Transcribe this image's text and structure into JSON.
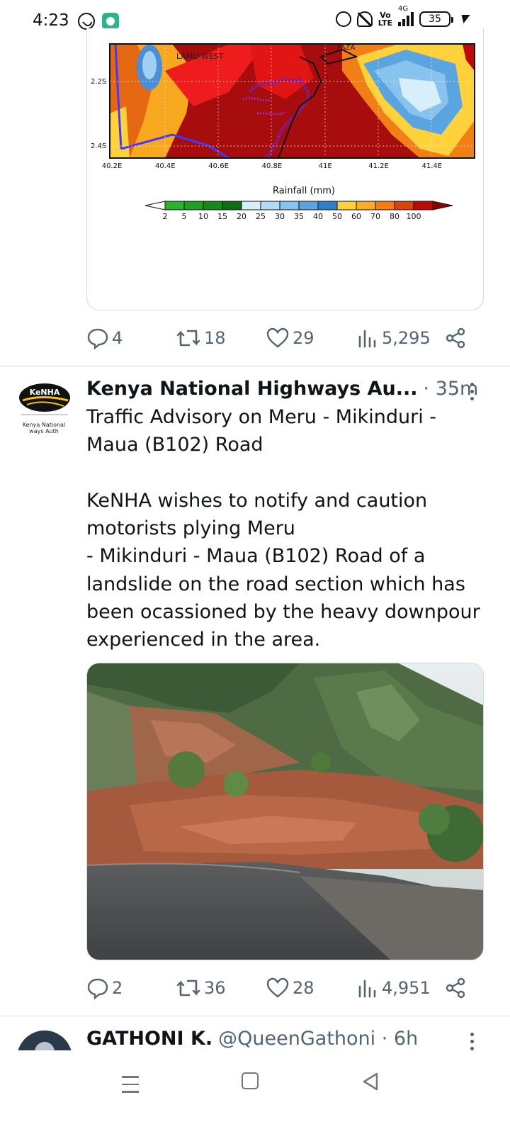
{
  "status_bar": {
    "time": "4:23",
    "network_top": "Vo",
    "network_bottom": "LTE",
    "network_type": "4G",
    "battery": "35",
    "icons": [
      "whatsapp-icon",
      "app-notification-icon",
      "alarm-icon",
      "mute-icon",
      "signal-icon",
      "battery-icon",
      "charging-icon"
    ]
  },
  "map_card": {
    "place_labels": [
      "LAMU WEST",
      "FAZA"
    ],
    "lat_ticks": [
      "2.2S",
      "2.4S"
    ],
    "lon_ticks": [
      "40.2E",
      "40.4E",
      "40.6E",
      "40.8E",
      "41E",
      "41.2E",
      "41.4E"
    ],
    "legend_title": "Rainfall (mm)",
    "legend_values": [
      "2",
      "5",
      "10",
      "15",
      "20",
      "25",
      "30",
      "35",
      "40",
      "50",
      "60",
      "70",
      "80",
      "100"
    ],
    "legend_colors": [
      "#ffffff",
      "#28b42a",
      "#1e9e23",
      "#158a1c",
      "#0c6e14",
      "#d7effb",
      "#b0dbf5",
      "#87c3ec",
      "#5aa5df",
      "#2f7fca",
      "#ffd23c",
      "#fcac22",
      "#f27e16",
      "#e0400e",
      "#c00808",
      "#8b0000"
    ]
  },
  "tweet1_actions": {
    "replies": "4",
    "retweets": "18",
    "likes": "29",
    "views": "5,295"
  },
  "tweet2": {
    "avatar_caption_line1": "Kenya National",
    "avatar_caption_line2": "ways Auth",
    "avatar_logo_text": "KeNHA",
    "author_name": "Kenya National Highways Au...",
    "time": "· 35m",
    "text": "Traffic Advisory on Meru - Mikinduri -\nMaua (B102) Road\n\nKeNHA wishes to notify and caution\nmotorists plying Meru\n- Mikinduri - Maua (B102) Road of a\nlandslide on the road section which has\nbeen ocassioned by the heavy downpour\nexperienced in the area.",
    "actions": {
      "replies": "2",
      "retweets": "36",
      "likes": "28",
      "views": "4,951"
    }
  },
  "tweet3": {
    "author_name": "GATHONI K.",
    "handle_time": "@QueenGathoni · 6h"
  },
  "colors": {
    "text_primary": "#0f1419",
    "text_secondary": "#536471",
    "border": "#cfd9de"
  }
}
